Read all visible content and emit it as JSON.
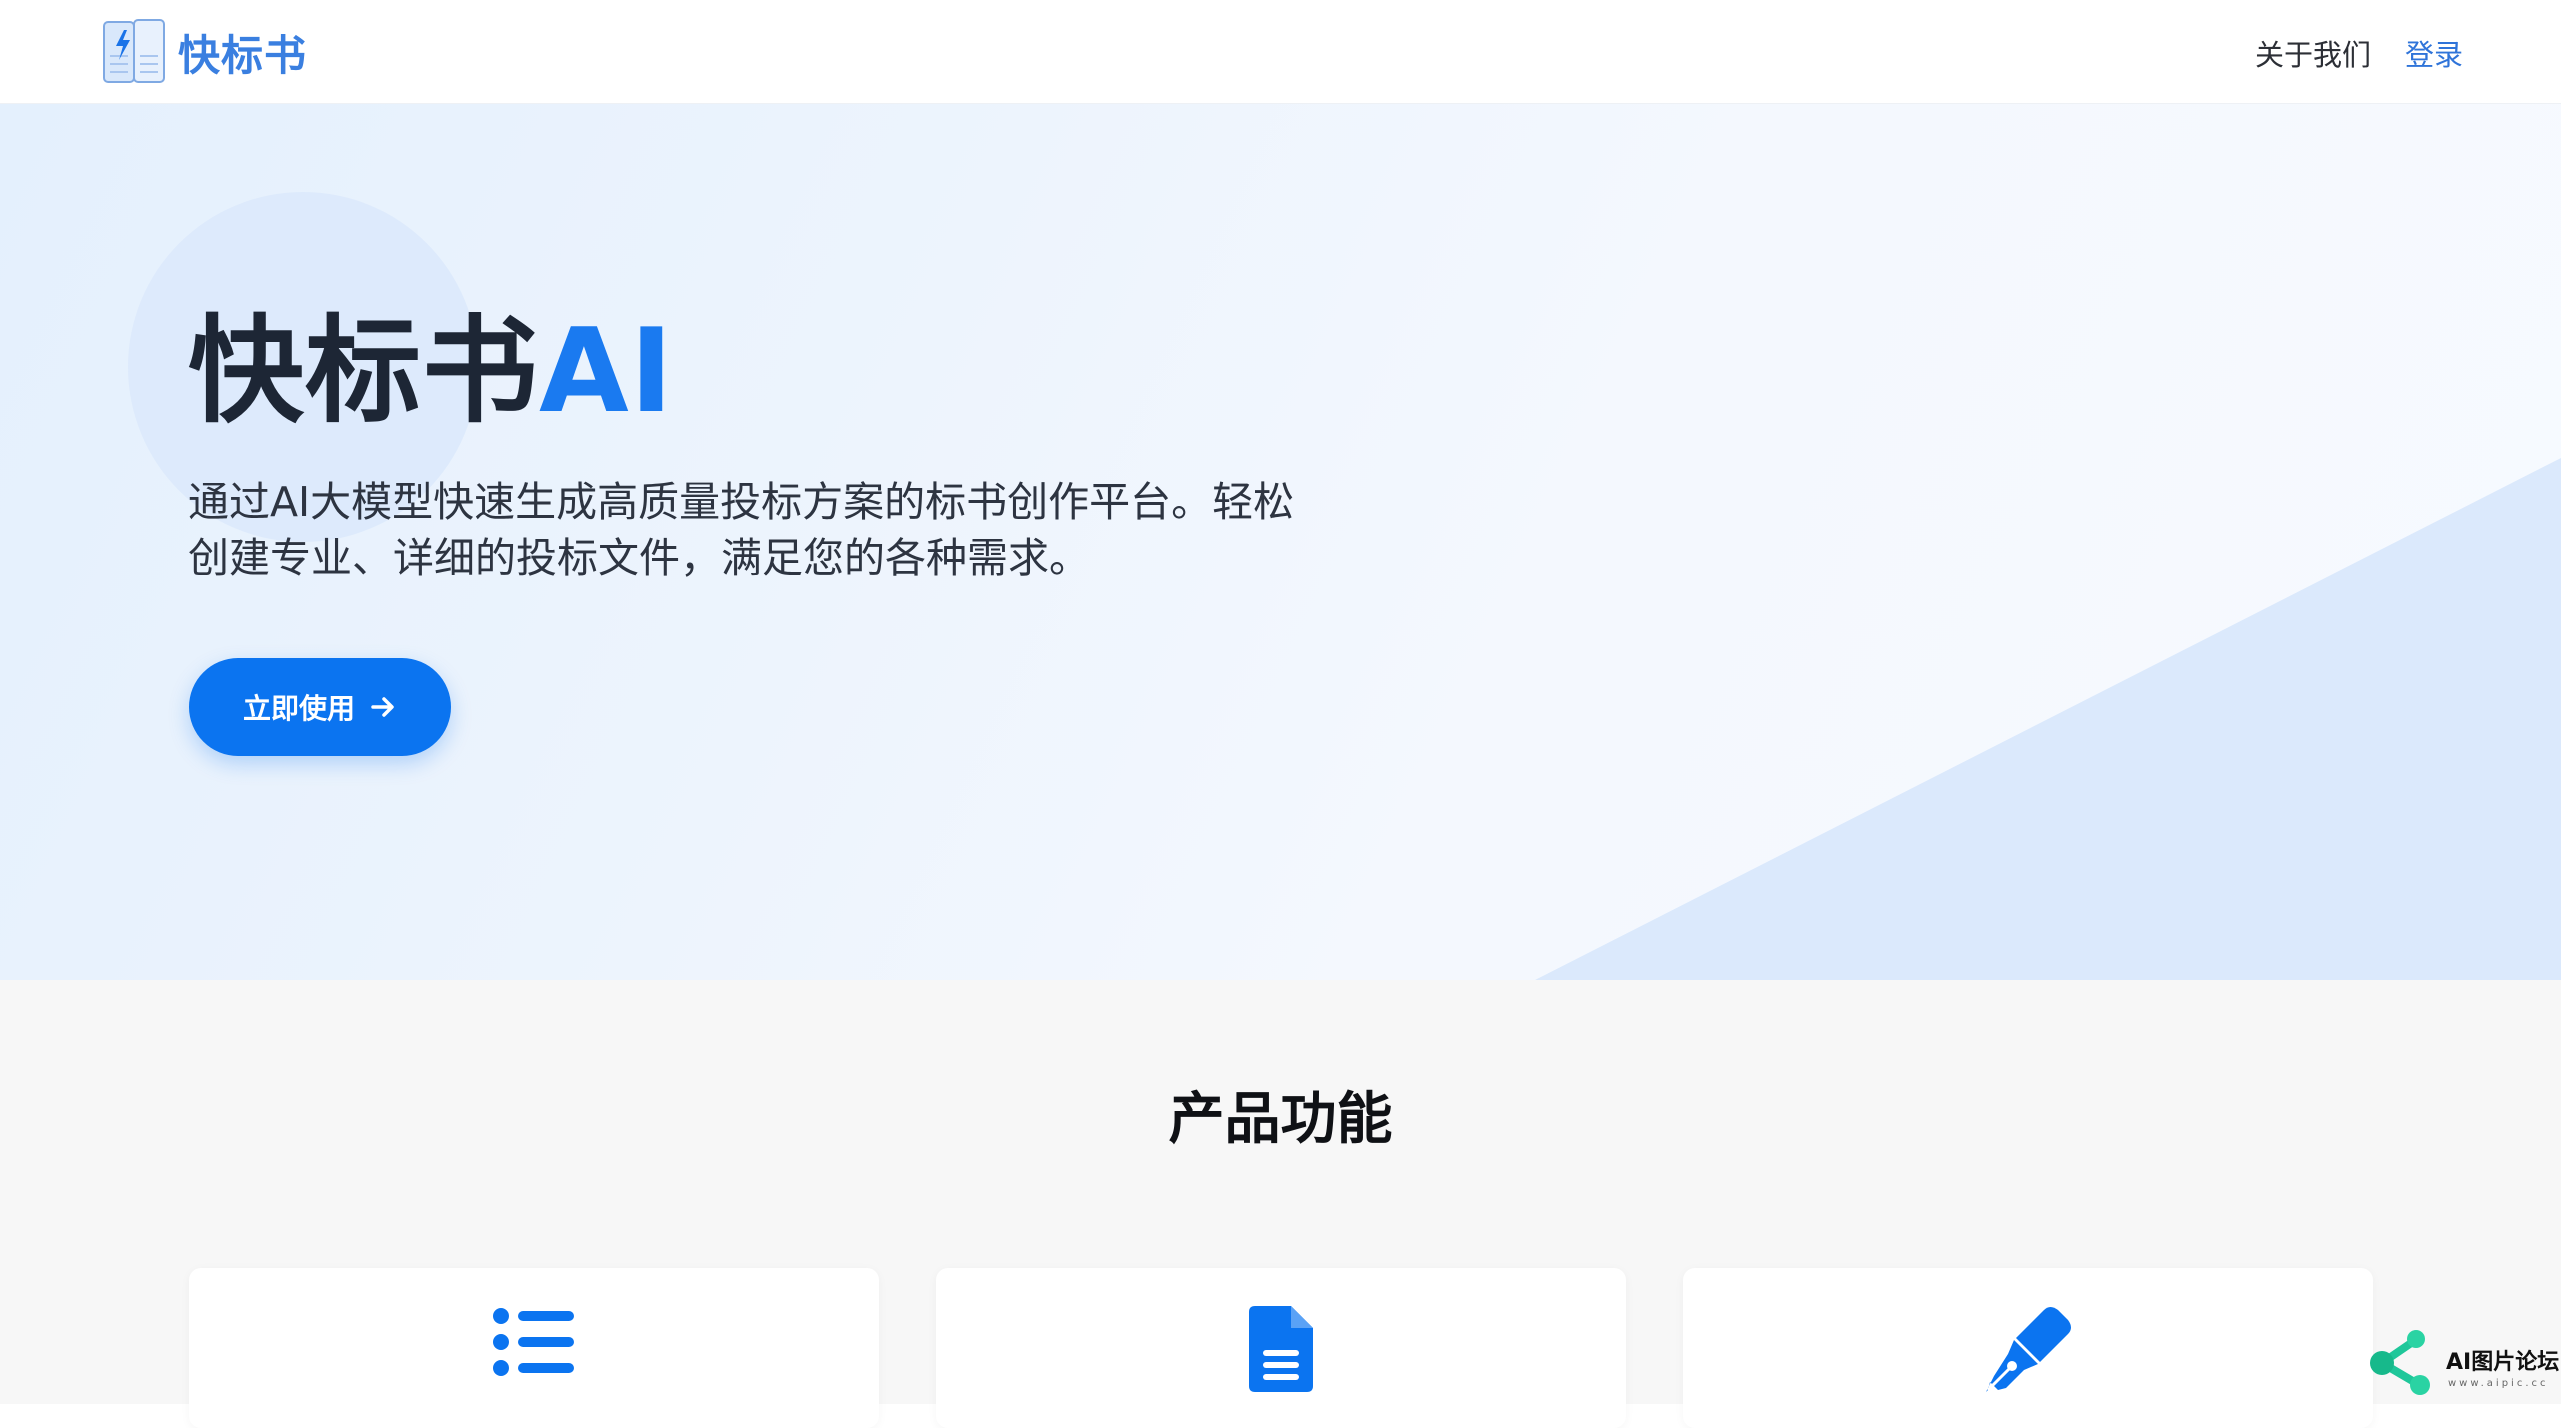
{
  "header": {
    "brand_name": "快标书",
    "nav": [
      {
        "label": "关于我们"
      },
      {
        "label": "登录"
      }
    ]
  },
  "hero": {
    "title_main": "快标书",
    "title_accent": "AI",
    "description": "通过AI大模型快速生成高质量投标方案的标书创作平台。轻松创建专业、详细的投标文件，满足您的各种需求。",
    "cta_label": "立即使用",
    "cta_icon": "arrow-right-icon"
  },
  "features": {
    "title": "产品功能",
    "cards": [
      {
        "icon": "list-icon"
      },
      {
        "icon": "document-icon"
      },
      {
        "icon": "pen-icon"
      }
    ]
  },
  "watermark": {
    "text": "AI图片论坛",
    "sub": "www.aipic.cc"
  },
  "colors": {
    "accent": "#0b74f0",
    "brand": "#3a7fe0",
    "title_dark": "#1d2635",
    "hero_bg": "#e9f2fd",
    "features_bg": "#f7f7f7"
  }
}
